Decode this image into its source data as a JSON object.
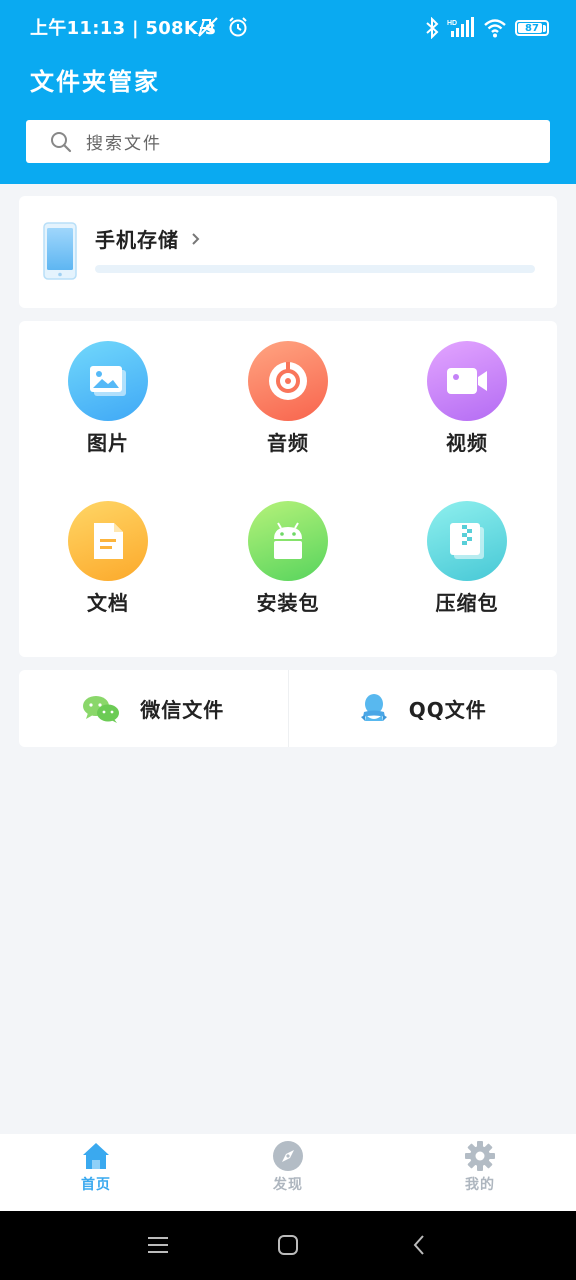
{
  "status_bar": {
    "time": "上午11:13 | 508K/s",
    "battery": "87",
    "battery_level": 0.87,
    "icons": [
      "mute-icon",
      "alarm-icon",
      "bluetooth-icon",
      "hd-signal-icon",
      "wifi-icon",
      "battery-icon"
    ]
  },
  "header": {
    "title": "文件夹管家",
    "search_placeholder": "搜索文件",
    "background": "#0aaaf1"
  },
  "storage": {
    "title": "手机存储",
    "usage_fraction": 0.0
  },
  "categories": [
    {
      "label": "图片",
      "icon": "image-icon",
      "color_from": "#72d8fb",
      "color_to": "#3fa8f6"
    },
    {
      "label": "音频",
      "icon": "music-disc-icon",
      "color_from": "#ffa582",
      "color_to": "#f8644d"
    },
    {
      "label": "视频",
      "icon": "video-camera-icon",
      "color_from": "#e3a5ff",
      "color_to": "#b46cf3"
    },
    {
      "label": "文档",
      "icon": "document-icon",
      "color_from": "#ffd666",
      "color_to": "#fca92b"
    },
    {
      "label": "安装包",
      "icon": "android-icon",
      "color_from": "#b6f27a",
      "color_to": "#57d45d"
    },
    {
      "label": "压缩包",
      "icon": "zip-icon",
      "color_from": "#8ff0ee",
      "color_to": "#47c8d6"
    }
  ],
  "quick_access": [
    {
      "label": "微信文件",
      "icon": "wechat-icon",
      "color": "#8ad76a"
    },
    {
      "label": "QQ文件",
      "icon": "qq-icon",
      "color": "#58b8ef"
    }
  ],
  "bottom_nav": [
    {
      "label": "首页",
      "icon": "home-icon",
      "active": true,
      "color": "#3aa9ef"
    },
    {
      "label": "发现",
      "icon": "compass-icon",
      "active": false,
      "color": "#b3bcc5"
    },
    {
      "label": "我的",
      "icon": "gear-icon",
      "active": false,
      "color": "#b3bcc5"
    }
  ],
  "system_nav": [
    "menu-icon",
    "home-square-icon",
    "back-icon"
  ]
}
